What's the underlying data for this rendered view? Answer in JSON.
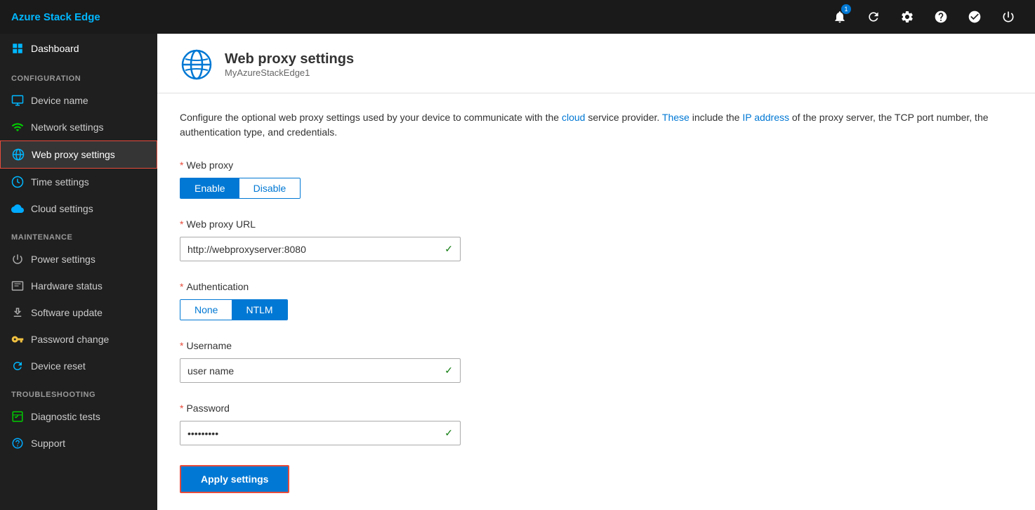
{
  "app": {
    "title": "Azure Stack Edge"
  },
  "topbar": {
    "notification_count": "1",
    "icons": [
      "bell",
      "refresh",
      "settings",
      "help",
      "feedback",
      "power"
    ]
  },
  "sidebar": {
    "dashboard_label": "Dashboard",
    "sections": [
      {
        "label": "CONFIGURATION",
        "items": [
          {
            "id": "device-name",
            "label": "Device name",
            "icon": "device"
          },
          {
            "id": "network-settings",
            "label": "Network settings",
            "icon": "network"
          },
          {
            "id": "web-proxy-settings",
            "label": "Web proxy settings",
            "icon": "webproxy",
            "active": true
          },
          {
            "id": "time-settings",
            "label": "Time settings",
            "icon": "time"
          },
          {
            "id": "cloud-settings",
            "label": "Cloud settings",
            "icon": "cloud"
          }
        ]
      },
      {
        "label": "MAINTENANCE",
        "items": [
          {
            "id": "power-settings",
            "label": "Power settings",
            "icon": "power"
          },
          {
            "id": "hardware-status",
            "label": "Hardware status",
            "icon": "hardware"
          },
          {
            "id": "software-update",
            "label": "Software update",
            "icon": "softwareupdate"
          },
          {
            "id": "password-change",
            "label": "Password change",
            "icon": "password"
          },
          {
            "id": "device-reset",
            "label": "Device reset",
            "icon": "devicereset"
          }
        ]
      },
      {
        "label": "TROUBLESHOOTING",
        "items": [
          {
            "id": "diagnostic-tests",
            "label": "Diagnostic tests",
            "icon": "diagnostic"
          },
          {
            "id": "support",
            "label": "Support",
            "icon": "support"
          }
        ]
      }
    ]
  },
  "content": {
    "page_title": "Web proxy settings",
    "page_subtitle": "MyAzureStackEdge1",
    "description": "Configure the optional web proxy settings used by your device to communicate with the cloud service provider. These include the IP address of the proxy server, the TCP port number, the authentication type, and credentials.",
    "web_proxy_label": "Web proxy",
    "web_proxy_enable": "Enable",
    "web_proxy_disable": "Disable",
    "web_proxy_url_label": "Web proxy URL",
    "web_proxy_url_value": "http://webproxyserver:8080",
    "authentication_label": "Authentication",
    "auth_none": "None",
    "auth_ntlm": "NTLM",
    "username_label": "Username",
    "username_value": "user name",
    "password_label": "Password",
    "password_value": "••••••••",
    "apply_button_label": "Apply settings"
  }
}
